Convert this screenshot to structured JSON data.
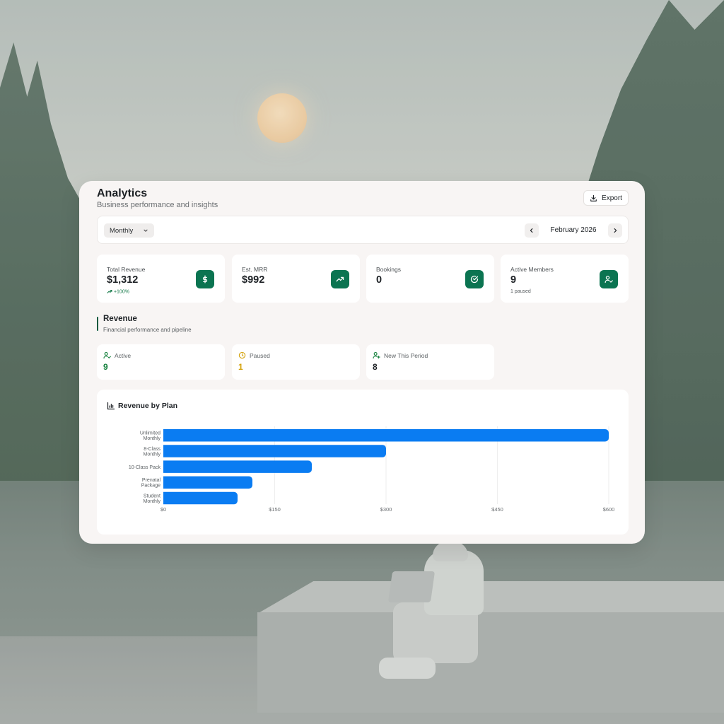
{
  "header": {
    "title": "Analytics",
    "subtitle": "Business performance and insights",
    "export_label": "Export"
  },
  "toolbar": {
    "period": "Monthly",
    "month": "February 2026"
  },
  "stats": [
    {
      "label": "Total Revenue",
      "value": "$1,312",
      "note": "+100%",
      "icon": "dollar-icon"
    },
    {
      "label": "Est. MRR",
      "value": "$992",
      "note": "",
      "icon": "trending-up-icon"
    },
    {
      "label": "Bookings",
      "value": "0",
      "note": "",
      "icon": "check-circle-icon"
    },
    {
      "label": "Active Members",
      "value": "9",
      "note": "1 paused",
      "icon": "user-check-icon"
    }
  ],
  "revenue_section": {
    "title": "Revenue",
    "subtitle": "Financial performance and pipeline"
  },
  "member_stats": [
    {
      "label": "Active",
      "value": "9",
      "color": "#15803d",
      "icon": "user-check-icon"
    },
    {
      "label": "Paused",
      "value": "1",
      "color": "#d4a20b",
      "icon": "clock-icon"
    },
    {
      "label": "New This Period",
      "value": "8",
      "color": "#1d2125",
      "icon": "user-plus-icon"
    }
  ],
  "colors": {
    "accent": "#0b7451",
    "bar": "#0a7cf2"
  },
  "chart_data": {
    "type": "bar",
    "orientation": "horizontal",
    "title": "Revenue by Plan",
    "categories": [
      [
        "Unlimited",
        "Monthly"
      ],
      [
        "8-Class",
        "Monthly"
      ],
      [
        "10-Class Pack"
      ],
      [
        "Prenatal",
        "Package"
      ],
      [
        "Student",
        "Monthly"
      ]
    ],
    "values": [
      600,
      300,
      200,
      120,
      100
    ],
    "xlim": [
      0,
      600
    ],
    "x_ticks": [
      0,
      150,
      300,
      450,
      600
    ],
    "x_tick_labels": [
      "$0",
      "$150",
      "$300",
      "$450",
      "$600"
    ],
    "grid": true
  }
}
